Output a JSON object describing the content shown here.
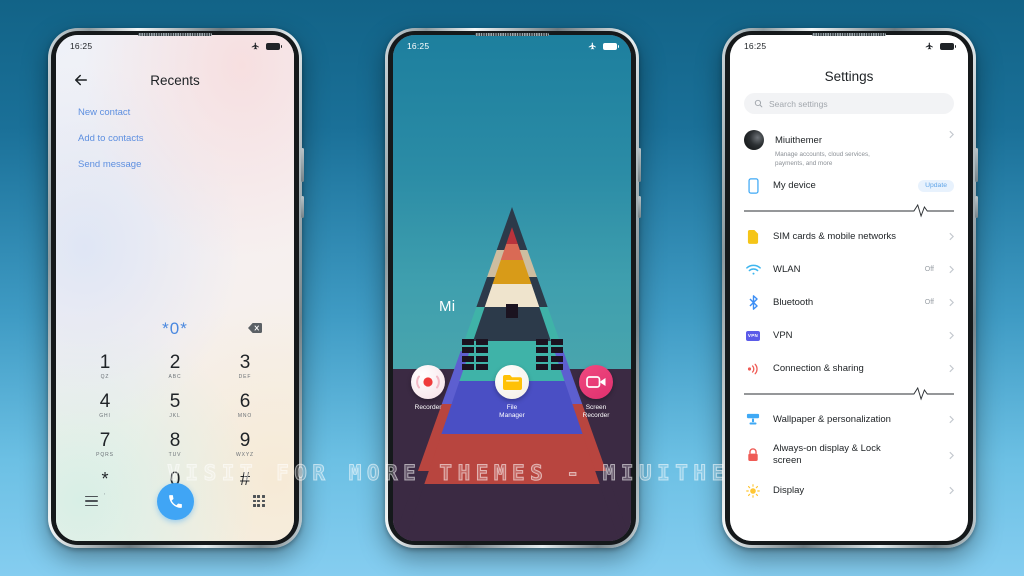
{
  "background": {
    "top_color": "#126387",
    "bottom_color": "#85cdf0"
  },
  "watermark": {
    "text": "VISIT  FOR  MORE  THEMES  -  MIUITHEMER.COM"
  },
  "phone_dialer": {
    "status_bar": {
      "time": "16:25",
      "airplane_icon": "airplane-icon",
      "battery_icon": "battery-icon"
    },
    "header": {
      "back_icon": "back-arrow-icon",
      "title": "Recents"
    },
    "quick_links": [
      {
        "label": "New contact"
      },
      {
        "label": "Add to contacts"
      },
      {
        "label": "Send message"
      }
    ],
    "input": {
      "value": "*0*",
      "backspace_icon": "backspace-icon"
    },
    "keypad": [
      {
        "num": "1",
        "sub": "QZ"
      },
      {
        "num": "2",
        "sub": "ABC"
      },
      {
        "num": "3",
        "sub": "DEF"
      },
      {
        "num": "4",
        "sub": "GHI"
      },
      {
        "num": "5",
        "sub": "JKL"
      },
      {
        "num": "6",
        "sub": "MNO"
      },
      {
        "num": "7",
        "sub": "PQRS"
      },
      {
        "num": "8",
        "sub": "TUV"
      },
      {
        "num": "9",
        "sub": "WXYZ"
      },
      {
        "num": "*",
        "sub": ","
      },
      {
        "num": "0",
        "sub": "+"
      },
      {
        "num": "#",
        "sub": ""
      }
    ],
    "bottom_bar": {
      "menu_icon": "menu-icon",
      "call_icon": "call-icon",
      "keypad_icon": "dialpad-icon",
      "call_button_color": "#40a5f5"
    }
  },
  "phone_home": {
    "status_bar": {
      "time": "16:25",
      "airplane_icon": "airplane-icon",
      "battery_icon": "battery-icon"
    },
    "folder_label": "Mi",
    "apps": [
      {
        "label": "Recorder",
        "icon": "recorder-icon"
      },
      {
        "label": "File\nManager",
        "label_line1": "File",
        "label_line2": "Manager",
        "icon": "folder-icon"
      },
      {
        "label": "Screen\nRecorder",
        "label_line1": "Screen",
        "label_line2": "Recorder",
        "icon": "screen-recorder-icon"
      }
    ],
    "wallpaper": {
      "sky_color": "#2b8ca6",
      "ground_color": "#3b2a43",
      "band_colors": [
        "#b8333c",
        "#d89b18",
        "#cdbda0",
        "#2c3a4a",
        "#3fb3a8",
        "#5d5fd0",
        "#4a4fc4",
        "#b8453f"
      ]
    }
  },
  "phone_settings": {
    "status_bar": {
      "time": "16:25",
      "airplane_icon": "airplane-icon",
      "battery_icon": "battery-icon"
    },
    "title": "Settings",
    "search": {
      "placeholder": "Search settings",
      "icon": "search-icon"
    },
    "account": {
      "name": "Miuithemer",
      "subtitle": "Manage accounts, cloud services,\npayments, and more",
      "subtitle_line1": "Manage accounts, cloud services,",
      "subtitle_line2": "payments, and more",
      "avatar": "avatar"
    },
    "my_device": {
      "label": "My device",
      "badge": "Update",
      "icon": "device-icon",
      "badge_color": "#5fa4e8"
    },
    "group_network": [
      {
        "label": "SIM cards & mobile networks",
        "value": "",
        "icon": "sim-icon",
        "color": "#f5c518"
      },
      {
        "label": "WLAN",
        "value": "Off",
        "icon": "wifi-icon",
        "color": "#3fb6ef"
      },
      {
        "label": "Bluetooth",
        "value": "Off",
        "icon": "bluetooth-icon",
        "color": "#3b8ef5"
      },
      {
        "label": "VPN",
        "value": "",
        "icon": "vpn-icon",
        "color": "#5b5be8"
      },
      {
        "label": "Connection & sharing",
        "value": "",
        "icon": "connection-sharing-icon",
        "color": "#ef5b55"
      }
    ],
    "group_personalization": [
      {
        "label": "Wallpaper & personalization",
        "value": "",
        "icon": "wallpaper-icon",
        "color": "#3fa9f5"
      },
      {
        "label_line1": "Always-on display & Lock",
        "label_line2": "screen",
        "label": "Always-on display & Lock screen",
        "value": "",
        "icon": "lock-icon",
        "color": "#ef5b55"
      },
      {
        "label": "Display",
        "value": "",
        "icon": "display-icon",
        "color": "#ffc632"
      }
    ]
  }
}
